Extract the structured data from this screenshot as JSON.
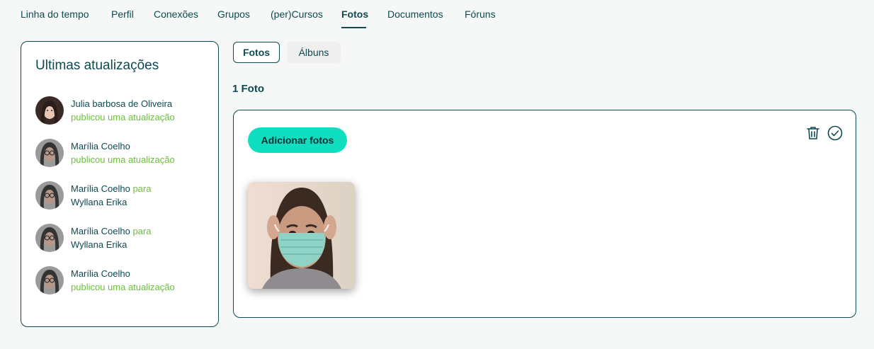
{
  "nav": {
    "tabs": [
      {
        "label": "Linha do tempo"
      },
      {
        "label": "Perfil"
      },
      {
        "label": "Conexões"
      },
      {
        "label": "Grupos"
      },
      {
        "label": "(per)Cursos"
      },
      {
        "label": "Fotos"
      },
      {
        "label": "Documentos"
      },
      {
        "label": "Fóruns"
      }
    ],
    "active": "Fotos"
  },
  "sidebar": {
    "title": "Ultimas atualizações",
    "items": [
      {
        "name": "Julia barbosa de Oliveira",
        "action": "publicou uma atualização"
      },
      {
        "name": "Marília Coelho",
        "action": "publicou uma atualização"
      },
      {
        "name": "Marília Coelho",
        "connector": "para",
        "target": "Wyllana Erika"
      },
      {
        "name": "Marília Coelho",
        "connector": "para",
        "target": "Wyllana Erika"
      },
      {
        "name": "Marília Coelho",
        "action": "publicou uma atualização"
      }
    ]
  },
  "subtabs": {
    "photos": "Fotos",
    "albums": "Álbuns",
    "active": "Fotos"
  },
  "photos": {
    "count_label": "1 Foto",
    "add_label": "Adicionar fotos"
  },
  "colors": {
    "primary": "#0d4a52",
    "accent": "#0fdec0",
    "green": "#6bbf3a",
    "background": "#f6f7f7"
  },
  "icons": {
    "delete": "trash-icon",
    "select": "check-circle-icon"
  }
}
